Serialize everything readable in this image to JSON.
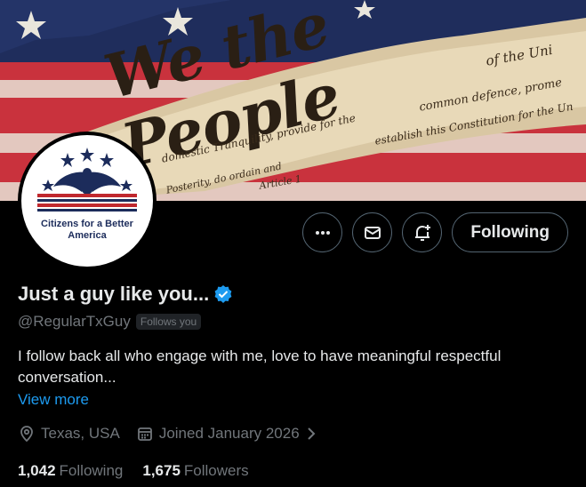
{
  "banner": {
    "main_text": "We the People",
    "script_lines": [
      "of the Uni",
      "common defence, prome",
      "domestic Tranquility, provide for the",
      "establish this Constitution for the Un",
      "Posterity, do ordain and",
      "Article 1"
    ]
  },
  "avatar": {
    "org_name": "Citizens for a Better America"
  },
  "actions": {
    "more_icon": "ellipsis-icon",
    "message_icon": "envelope-icon",
    "notify_icon": "bell-plus-icon",
    "follow_label": "Following"
  },
  "profile": {
    "display_name": "Just a guy like you...",
    "verified_icon": "verified-badge-icon",
    "handle": "@RegularTxGuy",
    "follows_you": "Follows you",
    "bio": "I follow back all who engage with me, love to have meaningful respectful conversation...",
    "view_more": "View more",
    "location": "Texas, USA",
    "joined": "Joined January 2026"
  },
  "stats": {
    "following_count": "1,042",
    "following_label": "Following",
    "followers_count": "1,675",
    "followers_label": "Followers"
  },
  "colors": {
    "accent": "#1d9bf0",
    "muted": "#71767b",
    "background": "#000000"
  }
}
